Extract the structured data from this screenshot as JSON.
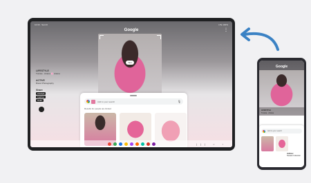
{
  "tablet": {
    "title": "Google",
    "status_left": "10:30 · Sat 23",
    "status_right": "LTE 100%",
    "photo_chip": "Text",
    "side": {
      "brand": "LIFESTYLE",
      "brand_sub": "Tunisie · Ariana 🌸 Ariana",
      "active_title": "ACTIVE",
      "active_sub": "Brand Photography",
      "share_title": "Share",
      "chips": [
        "Lifestyle",
        "Fashion",
        "Outfit"
      ]
    },
    "sheet": {
      "search_placeholder": "Add to your search",
      "results_note": "Results for people are limited"
    },
    "taskbar_apps": [
      "#ea4335",
      "#34a853",
      "#1a73e8",
      "#fbbc05",
      "#a142f4",
      "#ff6d00",
      "#00bfa5",
      "#d93025",
      "#7b1fa2"
    ],
    "nav": "|||  ○  ‹"
  },
  "phone": {
    "title": "Google",
    "brand": "LIFESTYLE",
    "brand_sub": "Tunisie · Ariana",
    "search_placeholder": "Add to your search",
    "caption_title": "Hollister",
    "caption_sub": "Sweater Collection"
  },
  "colors": {
    "arrow": "#3b82c4",
    "accent_pink": "#e0649a"
  }
}
